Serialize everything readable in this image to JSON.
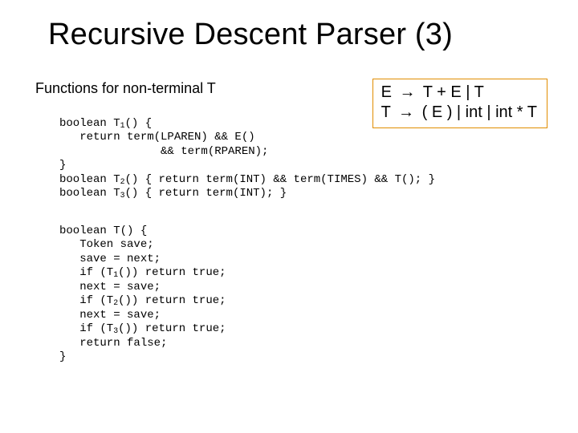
{
  "title": "Recursive Descent Parser (3)",
  "section": "Functions for non-terminal T",
  "grammar": {
    "line1_pre": "E ",
    "line1_post": " T + E | T",
    "line2_pre": "T ",
    "line2_post": " ( E ) | int  | int * T",
    "arrow": "→"
  },
  "code1": {
    "l0a": "boolean T",
    "l0s": "1",
    "l0b": "() {",
    "l1": "   return term(LPAREN) && E()",
    "l2": "               && term(RPAREN);",
    "l3": "}",
    "l4a": "boolean T",
    "l4s": "2",
    "l4b": "() { return term(INT) && term(TIMES) && T(); }",
    "l5a": "boolean T",
    "l5s": "3",
    "l5b": "() { return term(INT); }"
  },
  "code2": {
    "l0": "boolean T() {",
    "l1": "   Token save;",
    "l2": "   save = next;",
    "l3a": "   if (T",
    "l3s": "1",
    "l3b": "()) return true;",
    "l4": "   next = save;",
    "l5a": "   if (T",
    "l5s": "2",
    "l5b": "()) return true;",
    "l6": "   next = save;",
    "l7a": "   if (T",
    "l7s": "3",
    "l7b": "()) return true;",
    "l8": "   return false;",
    "l9": "}"
  }
}
